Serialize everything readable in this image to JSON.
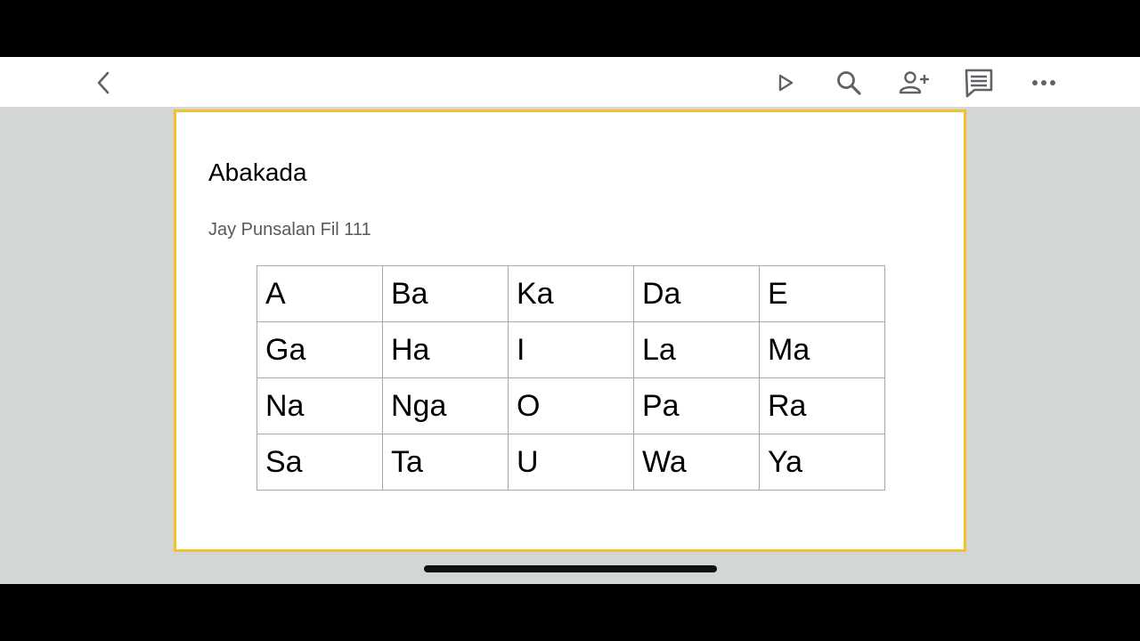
{
  "toolbar": {
    "back_icon": "chevron-left-icon",
    "present_icon": "play-icon",
    "search_icon": "search-icon",
    "share_icon": "add-person-icon",
    "comments_icon": "comment-icon",
    "more_icon": "more-horizontal-icon"
  },
  "slide": {
    "title": "Abakada",
    "subtitle": "Jay Punsalan Fil 111",
    "border_color": "#f2c12e",
    "table": [
      [
        "A",
        "Ba",
        "Ka",
        "Da",
        "E"
      ],
      [
        "Ga",
        "Ha",
        "I",
        "La",
        "Ma"
      ],
      [
        "Na",
        "Nga",
        "O",
        "Pa",
        "Ra"
      ],
      [
        "Sa",
        "Ta",
        "U",
        "Wa",
        "Ya"
      ]
    ]
  }
}
